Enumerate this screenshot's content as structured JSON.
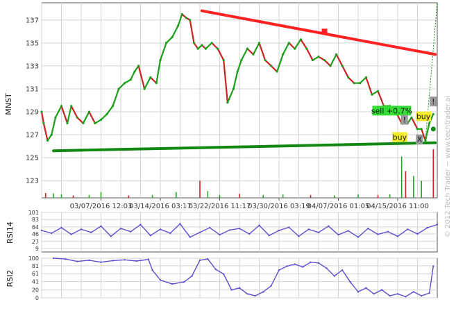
{
  "watermark": "© 2012 Tech Trader ~ www.techtrader.ai",
  "colors": {
    "price_up": "#1a9e1a",
    "price_down": "#cc2222",
    "resistance": "#ff2222",
    "support": "#118811",
    "rsi_line": "#5a4fd0",
    "volume_up": "#22aa22",
    "volume_down": "#cc2222",
    "grid": "#d4d4d4",
    "sell_label_bg": "#33dd33",
    "buy_label_bg": "#f5ee2a"
  },
  "chart_data": [
    {
      "type": "line",
      "ylabel": "MNST",
      "y_ticks": [
        "137",
        "135",
        "133",
        "131",
        "129",
        "127",
        "125",
        "123"
      ],
      "x_ticks": [
        "03/07/2016 12:03",
        "03/14/2016 03:17",
        "03/22/2016 11:17",
        "03/30/2016 03:19",
        "04/07/2016 01:05",
        "04/15/2016 11:00"
      ],
      "ylim": [
        121.5,
        138.5
      ],
      "grid": true,
      "x_domain": [
        0,
        100
      ],
      "series": [
        {
          "x": [
            0,
            0.5,
            1.5,
            2.5,
            3.5,
            5,
            6.5,
            7.5,
            9,
            10.5,
            12,
            13.5,
            15,
            16.5,
            18,
            19.5,
            21,
            22.5,
            23.5,
            24.5,
            26,
            27.5,
            29,
            30,
            31.5,
            33,
            34.5,
            35.5,
            36.5,
            37.5,
            38.5,
            39.5,
            40.5,
            41.5,
            43,
            44.5,
            46,
            47,
            48.5,
            49.5,
            50.5,
            52,
            53.5,
            55,
            56.5,
            58,
            59.5,
            61,
            62.5,
            64,
            65.5,
            67,
            68.5,
            70,
            71.5,
            73,
            74.5,
            76,
            77.5,
            79,
            80.5,
            82,
            83.5,
            85,
            86.5,
            88,
            89.5,
            91,
            92.5,
            93.5,
            95,
            96,
            97,
            98,
            99
          ],
          "values": [
            129,
            128,
            126.5,
            127,
            128.5,
            129.5,
            128,
            129.5,
            128.5,
            128,
            129,
            128,
            128.3,
            128.8,
            129.5,
            131,
            131.5,
            131.8,
            132.5,
            133,
            131,
            132,
            131.5,
            133.5,
            135,
            135.5,
            136.5,
            137.5,
            137.2,
            137,
            135,
            134.5,
            134.8,
            134.5,
            135,
            134.5,
            133.5,
            129.8,
            131,
            132.5,
            133.5,
            134.5,
            134,
            135,
            133.5,
            133,
            132.5,
            134,
            135,
            134.5,
            135.3,
            134.5,
            133.5,
            133.8,
            133.5,
            133,
            134,
            133,
            132,
            131.5,
            131.5,
            132,
            130.5,
            130.8,
            129.5,
            129.5,
            129,
            128,
            128,
            128.5,
            127.5,
            127.5,
            126.5,
            128,
            128.8
          ]
        }
      ],
      "trendlines": [
        {
          "name": "resistance",
          "x": [
            40.5,
            99.5
          ],
          "y": [
            137.8,
            134
          ]
        },
        {
          "name": "support",
          "x": [
            3,
            99.5
          ],
          "y": [
            125.6,
            126.3
          ]
        }
      ],
      "markers": [
        {
          "kind": "square",
          "x": 71.5,
          "y": 136
        }
      ],
      "annotations": [
        {
          "text": "sell +0.7%",
          "x": 88.5,
          "y": 129.1,
          "style": "sell"
        },
        {
          "text": "buy",
          "x": 96.5,
          "y": 128.6,
          "style": "buy"
        },
        {
          "text": "buy",
          "x": 90.5,
          "y": 126.8,
          "style": "buy"
        },
        {
          "text": "!",
          "x": 91.7,
          "y": 128.3,
          "style": "flag"
        },
        {
          "text": "!",
          "x": 99,
          "y": 129.9,
          "style": "flag"
        },
        {
          "text": "X",
          "x": 95.5,
          "y": 126.6,
          "style": "flag"
        }
      ],
      "volume": [
        {
          "x": 1,
          "v": 0.1
        },
        {
          "x": 3,
          "v": 0.09
        },
        {
          "x": 5,
          "v": 0.07
        },
        {
          "x": 8,
          "v": 0.05
        },
        {
          "x": 12,
          "v": 0.06
        },
        {
          "x": 15,
          "v": 0.12
        },
        {
          "x": 22,
          "v": 0.05
        },
        {
          "x": 28,
          "v": 0.06
        },
        {
          "x": 34,
          "v": 0.12
        },
        {
          "x": 40,
          "v": 0.35
        },
        {
          "x": 42,
          "v": 0.14
        },
        {
          "x": 45,
          "v": 0.06
        },
        {
          "x": 50,
          "v": 0.08
        },
        {
          "x": 56,
          "v": 0.06
        },
        {
          "x": 61,
          "v": 0.07
        },
        {
          "x": 68,
          "v": 0.06
        },
        {
          "x": 74,
          "v": 0.05
        },
        {
          "x": 80,
          "v": 0.07
        },
        {
          "x": 85,
          "v": 0.06
        },
        {
          "x": 88,
          "v": 0.07
        },
        {
          "x": 91,
          "v": 0.85
        },
        {
          "x": 92,
          "v": 0.55
        },
        {
          "x": 94,
          "v": 0.45
        },
        {
          "x": 96,
          "v": 0.35
        },
        {
          "x": 99,
          "v": 1.0
        }
      ]
    },
    {
      "type": "line",
      "ylabel": "RSI14",
      "y_ticks": [
        "101",
        "83",
        "64",
        "46",
        "27",
        "9"
      ],
      "ylim": [
        0,
        101
      ],
      "grid": true,
      "series": [
        {
          "name": "RSI14",
          "x": [
            0,
            2.5,
            5,
            7.5,
            10,
            12.5,
            15,
            17.5,
            20,
            22.5,
            25,
            27.5,
            30,
            32.5,
            35,
            37.5,
            40,
            42.5,
            45,
            47.5,
            50,
            52.5,
            55,
            57.5,
            60,
            62.5,
            65,
            67.5,
            70,
            72.5,
            75,
            77.5,
            80,
            82.5,
            85,
            87.5,
            90,
            92.5,
            95,
            97.5,
            100
          ],
          "values": [
            55,
            48,
            62,
            45,
            58,
            50,
            66,
            40,
            60,
            52,
            70,
            42,
            58,
            48,
            72,
            38,
            50,
            62,
            44,
            56,
            60,
            46,
            68,
            42,
            55,
            63,
            40,
            58,
            50,
            66,
            44,
            54,
            38,
            60,
            45,
            52,
            40,
            58,
            46,
            62,
            70
          ]
        }
      ]
    },
    {
      "type": "line",
      "ylabel": "RSI2",
      "y_ticks": [
        "100",
        "81",
        "61",
        "41",
        "20",
        "0"
      ],
      "ylim": [
        0,
        100
      ],
      "grid": true,
      "series": [
        {
          "name": "RSI2",
          "x": [
            3,
            6,
            9,
            12,
            15,
            18,
            21,
            24,
            27,
            28,
            30,
            33,
            36,
            38,
            40,
            42,
            44,
            46,
            48,
            50,
            52,
            54,
            56,
            58,
            60,
            62,
            64,
            66,
            68,
            70,
            72,
            74,
            76,
            78,
            80,
            82,
            84,
            86,
            88,
            90,
            92,
            94,
            96,
            98,
            99
          ],
          "values": [
            100,
            98,
            92,
            95,
            90,
            94,
            96,
            93,
            97,
            70,
            45,
            35,
            40,
            55,
            95,
            98,
            72,
            60,
            20,
            25,
            10,
            5,
            15,
            30,
            70,
            80,
            85,
            78,
            90,
            88,
            75,
            55,
            70,
            40,
            15,
            25,
            10,
            20,
            5,
            10,
            3,
            15,
            5,
            12,
            80
          ]
        }
      ]
    }
  ]
}
